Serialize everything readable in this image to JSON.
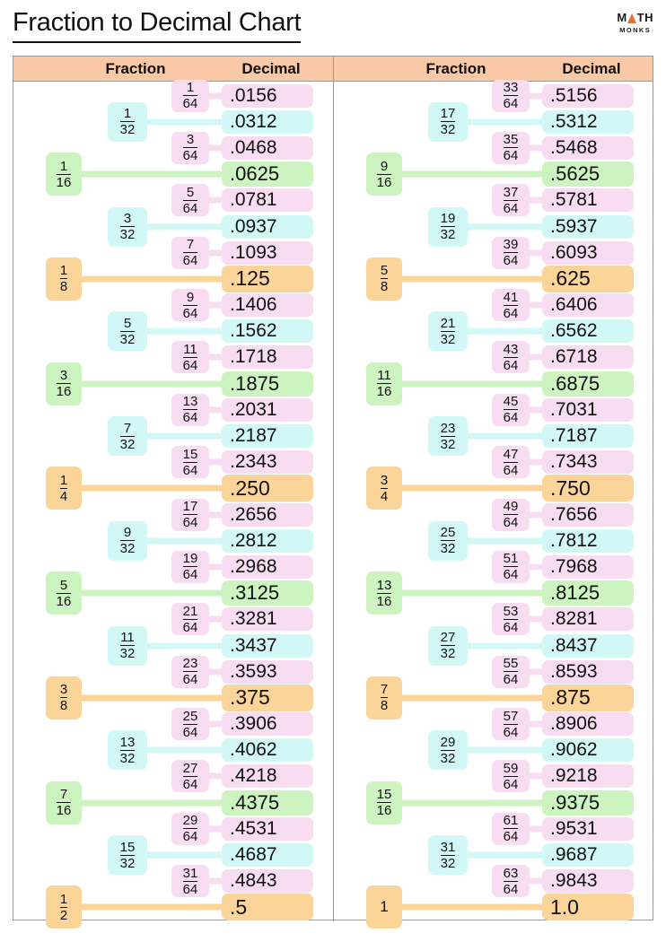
{
  "page": {
    "title": "Fraction to Decimal Chart",
    "logo": {
      "line1_before": "M",
      "line1_after": "TH",
      "line2": "MONKS",
      "triangle_color": "#ef6a32"
    }
  },
  "header": {
    "left_fraction": "Fraction",
    "left_decimal": "Decimal",
    "right_fraction": "Fraction",
    "right_decimal": "Decimal",
    "bar_color": "#f9c9a7"
  },
  "colors": {
    "sixtyfourth": "#f7dcf2",
    "thirtysecond": "#d2f7f7",
    "sixteenth": "#cdf3c0",
    "major": "#fbd49a",
    "border": "#9a9a9a",
    "text": "#111111"
  },
  "chart_data": {
    "type": "table",
    "title": "Fraction to Decimal Chart",
    "columns": [
      "Fraction",
      "Decimal"
    ],
    "left_column": [
      {
        "num": "1",
        "den": "64",
        "kind": "d64",
        "decimal": ".0156"
      },
      {
        "num": "1",
        "den": "32",
        "kind": "d32",
        "decimal": ".0312"
      },
      {
        "num": "3",
        "den": "64",
        "kind": "d64",
        "decimal": ".0468"
      },
      {
        "num": "1",
        "den": "16",
        "kind": "d16",
        "decimal": ".0625"
      },
      {
        "num": "5",
        "den": "64",
        "kind": "d64",
        "decimal": ".0781"
      },
      {
        "num": "3",
        "den": "32",
        "kind": "d32",
        "decimal": ".0937"
      },
      {
        "num": "7",
        "den": "64",
        "kind": "d64",
        "decimal": ".1093"
      },
      {
        "num": "1",
        "den": "8",
        "kind": "dmaj",
        "decimal": ".125"
      },
      {
        "num": "9",
        "den": "64",
        "kind": "d64",
        "decimal": ".1406"
      },
      {
        "num": "5",
        "den": "32",
        "kind": "d32",
        "decimal": ".1562"
      },
      {
        "num": "11",
        "den": "64",
        "kind": "d64",
        "decimal": ".1718"
      },
      {
        "num": "3",
        "den": "16",
        "kind": "d16",
        "decimal": ".1875"
      },
      {
        "num": "13",
        "den": "64",
        "kind": "d64",
        "decimal": ".2031"
      },
      {
        "num": "7",
        "den": "32",
        "kind": "d32",
        "decimal": ".2187"
      },
      {
        "num": "15",
        "den": "64",
        "kind": "d64",
        "decimal": ".2343"
      },
      {
        "num": "1",
        "den": "4",
        "kind": "dmaj",
        "decimal": ".250"
      },
      {
        "num": "17",
        "den": "64",
        "kind": "d64",
        "decimal": ".2656"
      },
      {
        "num": "9",
        "den": "32",
        "kind": "d32",
        "decimal": ".2812"
      },
      {
        "num": "19",
        "den": "64",
        "kind": "d64",
        "decimal": ".2968"
      },
      {
        "num": "5",
        "den": "16",
        "kind": "d16",
        "decimal": ".3125"
      },
      {
        "num": "21",
        "den": "64",
        "kind": "d64",
        "decimal": ".3281"
      },
      {
        "num": "11",
        "den": "32",
        "kind": "d32",
        "decimal": ".3437"
      },
      {
        "num": "23",
        "den": "64",
        "kind": "d64",
        "decimal": ".3593"
      },
      {
        "num": "3",
        "den": "8",
        "kind": "dmaj",
        "decimal": ".375"
      },
      {
        "num": "25",
        "den": "64",
        "kind": "d64",
        "decimal": ".3906"
      },
      {
        "num": "13",
        "den": "32",
        "kind": "d32",
        "decimal": ".4062"
      },
      {
        "num": "27",
        "den": "64",
        "kind": "d64",
        "decimal": ".4218"
      },
      {
        "num": "7",
        "den": "16",
        "kind": "d16",
        "decimal": ".4375"
      },
      {
        "num": "29",
        "den": "64",
        "kind": "d64",
        "decimal": ".4531"
      },
      {
        "num": "15",
        "den": "32",
        "kind": "d32",
        "decimal": ".4687"
      },
      {
        "num": "31",
        "den": "64",
        "kind": "d64",
        "decimal": ".4843"
      },
      {
        "num": "1",
        "den": "2",
        "kind": "dmaj",
        "decimal": ".5"
      }
    ],
    "right_column": [
      {
        "num": "33",
        "den": "64",
        "kind": "d64",
        "decimal": ".5156"
      },
      {
        "num": "17",
        "den": "32",
        "kind": "d32",
        "decimal": ".5312"
      },
      {
        "num": "35",
        "den": "64",
        "kind": "d64",
        "decimal": ".5468"
      },
      {
        "num": "9",
        "den": "16",
        "kind": "d16",
        "decimal": ".5625"
      },
      {
        "num": "37",
        "den": "64",
        "kind": "d64",
        "decimal": ".5781"
      },
      {
        "num": "19",
        "den": "32",
        "kind": "d32",
        "decimal": ".5937"
      },
      {
        "num": "39",
        "den": "64",
        "kind": "d64",
        "decimal": ".6093"
      },
      {
        "num": "5",
        "den": "8",
        "kind": "dmaj",
        "decimal": ".625"
      },
      {
        "num": "41",
        "den": "64",
        "kind": "d64",
        "decimal": ".6406"
      },
      {
        "num": "21",
        "den": "32",
        "kind": "d32",
        "decimal": ".6562"
      },
      {
        "num": "43",
        "den": "64",
        "kind": "d64",
        "decimal": ".6718"
      },
      {
        "num": "11",
        "den": "16",
        "kind": "d16",
        "decimal": ".6875"
      },
      {
        "num": "45",
        "den": "64",
        "kind": "d64",
        "decimal": ".7031"
      },
      {
        "num": "23",
        "den": "32",
        "kind": "d32",
        "decimal": ".7187"
      },
      {
        "num": "47",
        "den": "64",
        "kind": "d64",
        "decimal": ".7343"
      },
      {
        "num": "3",
        "den": "4",
        "kind": "dmaj",
        "decimal": ".750"
      },
      {
        "num": "49",
        "den": "64",
        "kind": "d64",
        "decimal": ".7656"
      },
      {
        "num": "25",
        "den": "32",
        "kind": "d32",
        "decimal": ".7812"
      },
      {
        "num": "51",
        "den": "64",
        "kind": "d64",
        "decimal": ".7968"
      },
      {
        "num": "13",
        "den": "16",
        "kind": "d16",
        "decimal": ".8125"
      },
      {
        "num": "53",
        "den": "64",
        "kind": "d64",
        "decimal": ".8281"
      },
      {
        "num": "27",
        "den": "32",
        "kind": "d32",
        "decimal": ".8437"
      },
      {
        "num": "55",
        "den": "64",
        "kind": "d64",
        "decimal": ".8593"
      },
      {
        "num": "7",
        "den": "8",
        "kind": "dmaj",
        "decimal": ".875"
      },
      {
        "num": "57",
        "den": "64",
        "kind": "d64",
        "decimal": ".8906"
      },
      {
        "num": "29",
        "den": "32",
        "kind": "d32",
        "decimal": ".9062"
      },
      {
        "num": "59",
        "den": "64",
        "kind": "d64",
        "decimal": ".9218"
      },
      {
        "num": "15",
        "den": "16",
        "kind": "d16",
        "decimal": ".9375"
      },
      {
        "num": "61",
        "den": "64",
        "kind": "d64",
        "decimal": ".9531"
      },
      {
        "num": "31",
        "den": "32",
        "kind": "d32",
        "decimal": ".9687"
      },
      {
        "num": "63",
        "den": "64",
        "kind": "d64",
        "decimal": ".9843"
      },
      {
        "num": "1",
        "den": "",
        "kind": "dmaj",
        "decimal": "1.0"
      }
    ]
  }
}
